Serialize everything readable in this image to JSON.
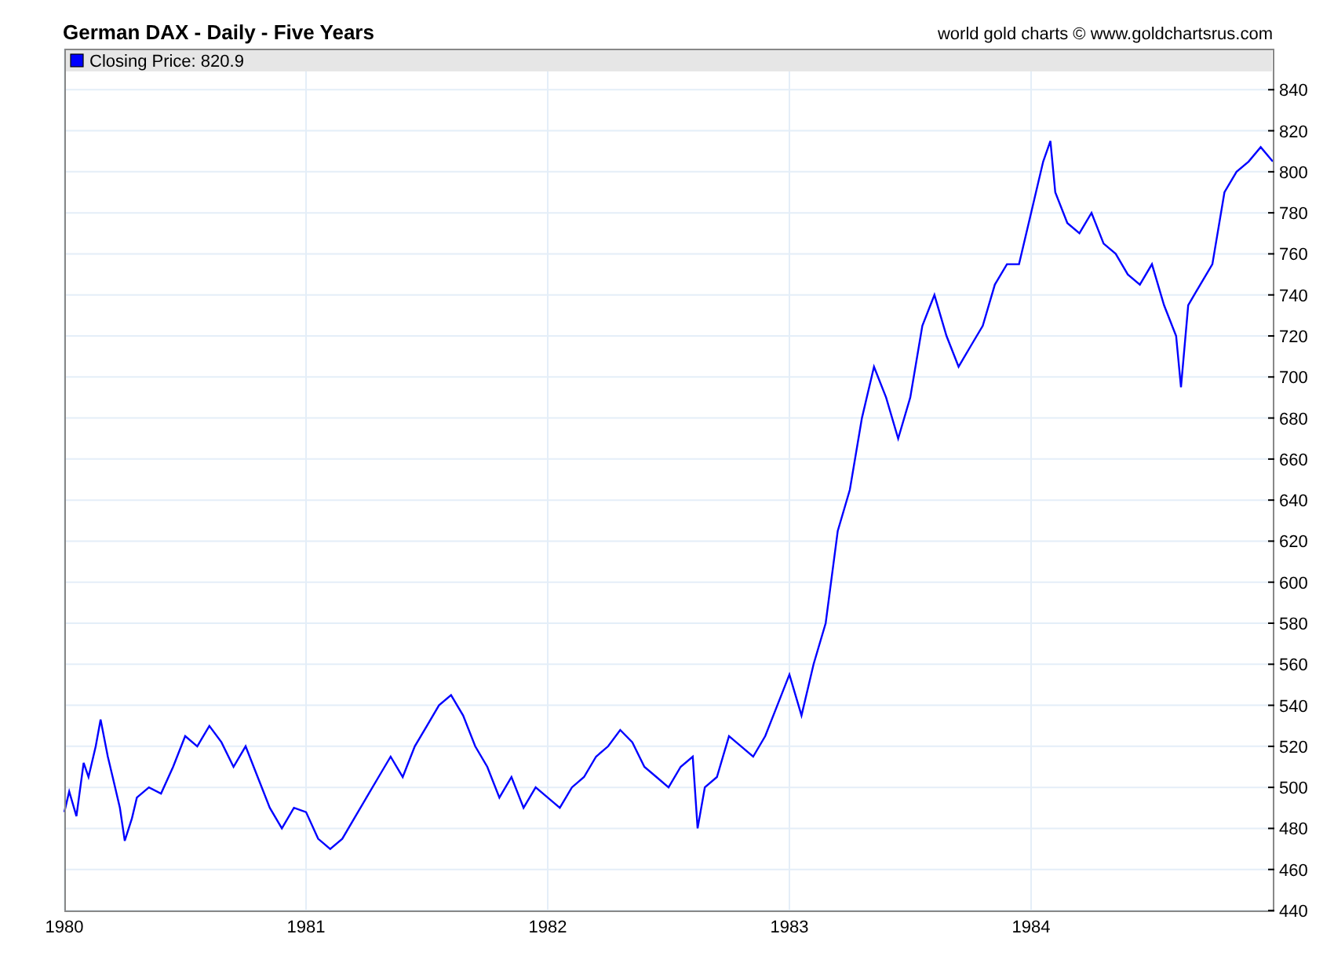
{
  "credit": "world gold charts © www.goldchartsrus.com",
  "legend": {
    "label": "Closing Price: 820.9",
    "color": "#0000ff"
  },
  "chart_data": {
    "type": "line",
    "title": "German DAX - Daily - Five Years",
    "grid": true,
    "xlim": [
      1980,
      1985
    ],
    "ylim": [
      440,
      860
    ],
    "xticks": [
      1980,
      1981,
      1982,
      1983,
      1984
    ],
    "yticks": [
      440,
      460,
      480,
      500,
      520,
      540,
      560,
      580,
      600,
      620,
      640,
      660,
      680,
      700,
      720,
      740,
      760,
      780,
      800,
      820,
      840
    ],
    "x": [
      1980.0,
      1980.02,
      1980.05,
      1980.08,
      1980.1,
      1980.13,
      1980.15,
      1980.18,
      1980.2,
      1980.23,
      1980.25,
      1980.28,
      1980.3,
      1980.35,
      1980.4,
      1980.45,
      1980.5,
      1980.55,
      1980.6,
      1980.65,
      1980.7,
      1980.75,
      1980.8,
      1980.85,
      1980.9,
      1980.95,
      1981.0,
      1981.05,
      1981.1,
      1981.15,
      1981.2,
      1981.25,
      1981.3,
      1981.35,
      1981.4,
      1981.45,
      1981.5,
      1981.55,
      1981.6,
      1981.65,
      1981.7,
      1981.75,
      1981.8,
      1981.85,
      1981.9,
      1981.95,
      1982.0,
      1982.05,
      1982.1,
      1982.15,
      1982.2,
      1982.25,
      1982.3,
      1982.35,
      1982.4,
      1982.45,
      1982.5,
      1982.55,
      1982.6,
      1982.62,
      1982.65,
      1982.7,
      1982.75,
      1982.8,
      1982.85,
      1982.9,
      1982.95,
      1983.0,
      1983.05,
      1983.1,
      1983.15,
      1983.2,
      1983.25,
      1983.3,
      1983.35,
      1983.4,
      1983.45,
      1983.5,
      1983.55,
      1983.6,
      1983.65,
      1983.7,
      1983.75,
      1983.8,
      1983.85,
      1983.9,
      1983.95,
      1984.0,
      1984.05,
      1984.08,
      1984.1,
      1984.15,
      1984.2,
      1984.25,
      1984.3,
      1984.35,
      1984.4,
      1984.45,
      1984.5,
      1984.55,
      1984.6,
      1984.62,
      1984.65,
      1984.7,
      1984.75,
      1984.8,
      1984.85,
      1984.9,
      1984.95,
      1985.0
    ],
    "series": [
      {
        "color": "#0000ff",
        "values": [
          488,
          498,
          486,
          512,
          505,
          520,
          533,
          515,
          505,
          490,
          474,
          485,
          495,
          500,
          497,
          510,
          525,
          520,
          530,
          522,
          510,
          520,
          505,
          490,
          480,
          490,
          488,
          475,
          470,
          475,
          485,
          495,
          505,
          515,
          505,
          520,
          530,
          540,
          545,
          535,
          520,
          510,
          495,
          505,
          490,
          500,
          495,
          490,
          500,
          505,
          515,
          520,
          528,
          522,
          510,
          505,
          500,
          510,
          515,
          480,
          500,
          505,
          525,
          520,
          515,
          525,
          540,
          555,
          535,
          560,
          580,
          625,
          645,
          680,
          705,
          690,
          670,
          690,
          725,
          740,
          720,
          705,
          715,
          725,
          745,
          755,
          755,
          780,
          805,
          815,
          790,
          775,
          770,
          780,
          765,
          760,
          750,
          745,
          755,
          735,
          720,
          695,
          735,
          745,
          755,
          790,
          800,
          805,
          812,
          805
        ]
      }
    ]
  }
}
